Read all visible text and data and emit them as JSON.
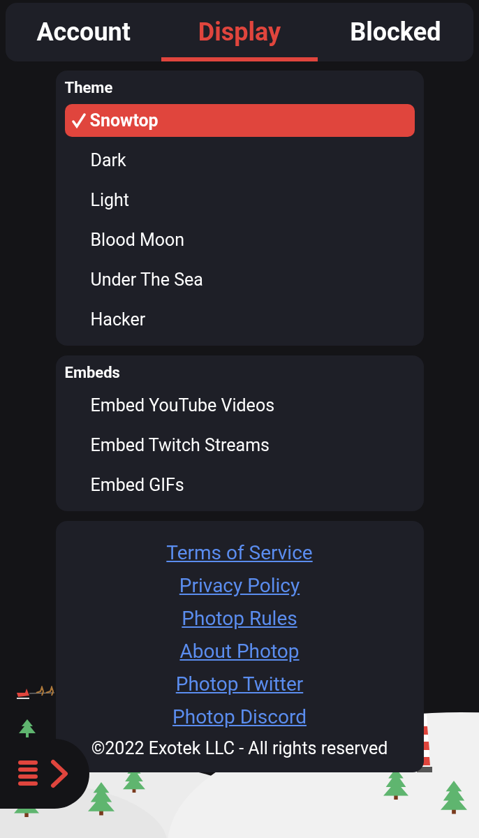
{
  "tabs": [
    {
      "label": "Account",
      "selected": false
    },
    {
      "label": "Display",
      "selected": true
    },
    {
      "label": "Blocked",
      "selected": false
    }
  ],
  "theme": {
    "title": "Theme",
    "options": [
      {
        "label": "Snowtop",
        "selected": true
      },
      {
        "label": "Dark",
        "selected": false
      },
      {
        "label": "Light",
        "selected": false
      },
      {
        "label": "Blood Moon",
        "selected": false
      },
      {
        "label": "Under The Sea",
        "selected": false
      },
      {
        "label": "Hacker",
        "selected": false
      }
    ]
  },
  "embeds": {
    "title": "Embeds",
    "options": [
      {
        "label": "Embed YouTube Videos",
        "checked": false
      },
      {
        "label": "Embed Twitch Streams",
        "checked": false
      },
      {
        "label": "Embed GIFs",
        "checked": false
      }
    ]
  },
  "links": [
    "Terms of Service",
    "Privacy Policy",
    "Photop Rules",
    "About Photop",
    "Photop Twitter",
    "Photop Discord"
  ],
  "copyright": "©2022 Exotek LLC - All rights reserved"
}
